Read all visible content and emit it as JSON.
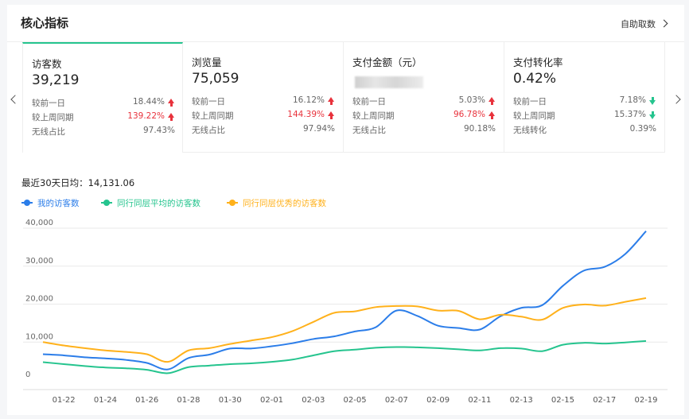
{
  "header": {
    "title": "核心指标",
    "link": "自助取数"
  },
  "cards": [
    {
      "name": "访客数",
      "value": "39,219",
      "rows": [
        {
          "label": "较前一日",
          "value": "18.44%",
          "dir": "up",
          "red": false
        },
        {
          "label": "较上周同期",
          "value": "139.22%",
          "dir": "up",
          "red": true
        },
        {
          "label": "无线占比",
          "value": "97.43%",
          "dir": "",
          "red": false
        }
      ]
    },
    {
      "name": "浏览量",
      "value": "75,059",
      "rows": [
        {
          "label": "较前一日",
          "value": "16.12%",
          "dir": "up",
          "red": false
        },
        {
          "label": "较上周同期",
          "value": "144.39%",
          "dir": "up",
          "red": true
        },
        {
          "label": "无线占比",
          "value": "97.94%",
          "dir": "",
          "red": false
        }
      ]
    },
    {
      "name": "支付金额（元）",
      "value": "",
      "rows": [
        {
          "label": "较前一日",
          "value": "5.03%",
          "dir": "up",
          "red": false
        },
        {
          "label": "较上周同期",
          "value": "96.78%",
          "dir": "up",
          "red": true
        },
        {
          "label": "无线占比",
          "value": "90.18%",
          "dir": "",
          "red": false
        }
      ]
    },
    {
      "name": "支付转化率",
      "value": "0.42%",
      "rows": [
        {
          "label": "较前一日",
          "value": "7.18%",
          "dir": "down",
          "red": false
        },
        {
          "label": "较上周同期",
          "value": "15.37%",
          "dir": "down",
          "red": false
        },
        {
          "label": "无线转化",
          "value": "0.39%",
          "dir": "",
          "red": false
        }
      ]
    }
  ],
  "average": "最近30天日均：14,131.06",
  "colors": {
    "accent": "#25c48e",
    "up": "#e8323c",
    "down": "#25c48e"
  },
  "chart_data": {
    "type": "line",
    "ylim": [
      0,
      40000
    ],
    "yticks": [
      "0",
      "10,000",
      "20,000",
      "30,000",
      "40,000"
    ],
    "x": [
      "01-21",
      "01-22",
      "01-23",
      "01-24",
      "01-25",
      "01-26",
      "01-27",
      "01-28",
      "01-29",
      "01-30",
      "01-31",
      "02-01",
      "02-02",
      "02-03",
      "02-04",
      "02-05",
      "02-06",
      "02-07",
      "02-08",
      "02-09",
      "02-10",
      "02-11",
      "02-12",
      "02-13",
      "02-14",
      "02-15",
      "02-16",
      "02-17",
      "02-18",
      "02-19"
    ],
    "xtick_labels": [
      "01-22",
      "01-24",
      "01-26",
      "01-28",
      "01-30",
      "02-01",
      "02-03",
      "02-05",
      "02-07",
      "02-09",
      "02-11",
      "02-13",
      "02-15",
      "02-17",
      "02-19"
    ],
    "legend": "top-left",
    "grid": true,
    "series": [
      {
        "name": "我的访客数",
        "color": "#2b7de9",
        "values": [
          6800,
          6500,
          6000,
          5700,
          5300,
          4500,
          2800,
          5800,
          6700,
          8300,
          8300,
          8900,
          9700,
          10800,
          11500,
          12800,
          13900,
          18300,
          16900,
          14300,
          13700,
          13300,
          16800,
          19000,
          19700,
          24800,
          28800,
          29800,
          33200,
          39219
        ]
      },
      {
        "name": "同行同层平均的访客数",
        "color": "#25c48e",
        "values": [
          4700,
          4200,
          3700,
          3300,
          3100,
          2700,
          1800,
          3400,
          3800,
          4200,
          4400,
          4800,
          5400,
          6500,
          7600,
          8000,
          8500,
          8700,
          8600,
          8400,
          8100,
          7800,
          8400,
          8300,
          7600,
          9300,
          9800,
          9600,
          9900,
          10300
        ]
      },
      {
        "name": "同行同层优秀的访客数",
        "color": "#ffb11b",
        "values": [
          10000,
          9100,
          8400,
          7800,
          7400,
          6800,
          4800,
          7800,
          8400,
          9500,
          10400,
          11300,
          12900,
          15300,
          17700,
          18100,
          19200,
          19500,
          19400,
          18300,
          18200,
          16000,
          17200,
          16700,
          15900,
          19000,
          19900,
          19600,
          20600,
          21600
        ]
      }
    ]
  }
}
